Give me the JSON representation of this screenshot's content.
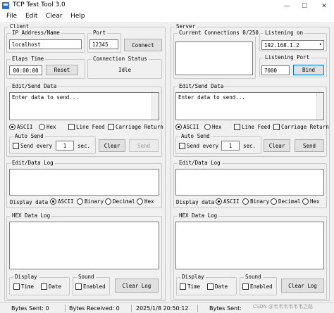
{
  "window": {
    "title": "TCP Test Tool 3.0",
    "minimize": "—",
    "maximize": "☐",
    "close": "✕"
  },
  "menu": {
    "file": "File",
    "edit": "Edit",
    "clear": "Clear",
    "help": "Help"
  },
  "client": {
    "group_label": "Client",
    "ip_label": "IP Address/Name",
    "ip_value": "localhost",
    "port_label": "Port",
    "port_value": "12345",
    "connect": "Connect",
    "elaps_label": "Elaps Time",
    "elaps_value": "00:00:00",
    "reset": "Reset",
    "conn_status_label": "Connection Status",
    "conn_status_value": "Idle",
    "edit_send_label": "Edit/Send Data",
    "send_placeholder": "Enter data to send...",
    "ascii": "ASCII",
    "hex": "Hex",
    "line_feed": "Line Feed",
    "carriage_return": "Carriage Return",
    "auto_send_label": "Auto Send",
    "send_every": "Send every",
    "interval": "1",
    "sec": "sec.",
    "clear": "Clear",
    "send": "Send",
    "edit_log_label": "Edit/Data Log",
    "display_data": "Display data",
    "binary": "Binary",
    "decimal": "Decimal",
    "hex_log_label": "HEX Data Log",
    "display_label": "Display",
    "time": "Time",
    "date": "Date",
    "sound_label": "Sound",
    "enabled": "Enabled",
    "clear_log": "Clear Log"
  },
  "server": {
    "group_label": "Server",
    "current_connections": "Current Connections 0/250",
    "listening_on_label": "Listening on",
    "listening_on_value": "192.168.1.2",
    "listening_port_label": "Listening Port",
    "port_value": "7000",
    "bind": "Bind",
    "edit_send_label": "Edit/Send Data",
    "send_placeholder": "Enter data to send...",
    "ascii": "ASCII",
    "hex": "Hex",
    "line_feed": "Line Feed",
    "carriage_return": "Carriage Return",
    "auto_send_label": "Auto Send",
    "send_every": "Send every",
    "interval": "1",
    "sec": "sec.",
    "clear": "Clear",
    "send": "Send",
    "edit_log_label": "Edit/Data Log",
    "display_data": "Display data",
    "binary": "Binary",
    "decimal": "Decimal",
    "hex_log_label": "HEX Data Log",
    "display_label": "Display",
    "time": "Time",
    "date": "Date",
    "sound_label": "Sound",
    "enabled": "Enabled",
    "clear_log": "Clear Log"
  },
  "status": {
    "bytes_sent_left": "Bytes Sent: 0",
    "bytes_received_left": "Bytes Received: 0",
    "datetime": "2025/1/8 20:50:12",
    "bytes_sent_right": "Bytes Sent:",
    "watermark": "CSDN @韦韦韦韦韦韦之路"
  },
  "colors": {
    "accent": "#0078d7",
    "background": "#f0f0f0"
  }
}
